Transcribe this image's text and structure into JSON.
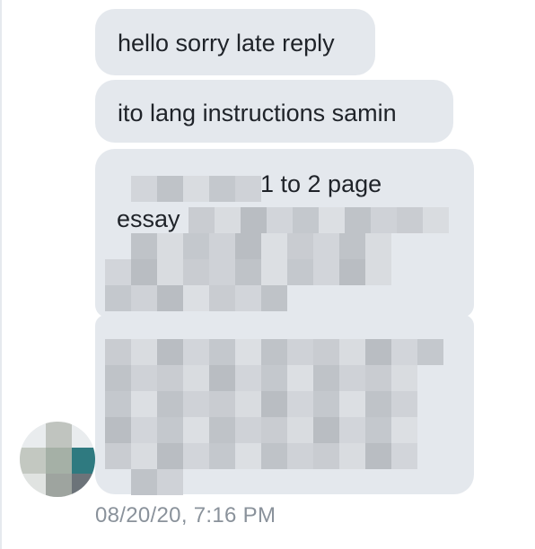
{
  "conversation": {
    "messages": [
      {
        "text": "hello sorry late reply"
      },
      {
        "text": "ito lang instructions samin"
      },
      {
        "text_line1_visible": "1 to 2 page",
        "text_line2_visible": "essay"
      }
    ],
    "timestamp": "08/20/20, 7:16 PM"
  },
  "colors": {
    "bubble": "#e4e8ed",
    "text": "#1f2329",
    "timestamp": "#8a929b"
  }
}
